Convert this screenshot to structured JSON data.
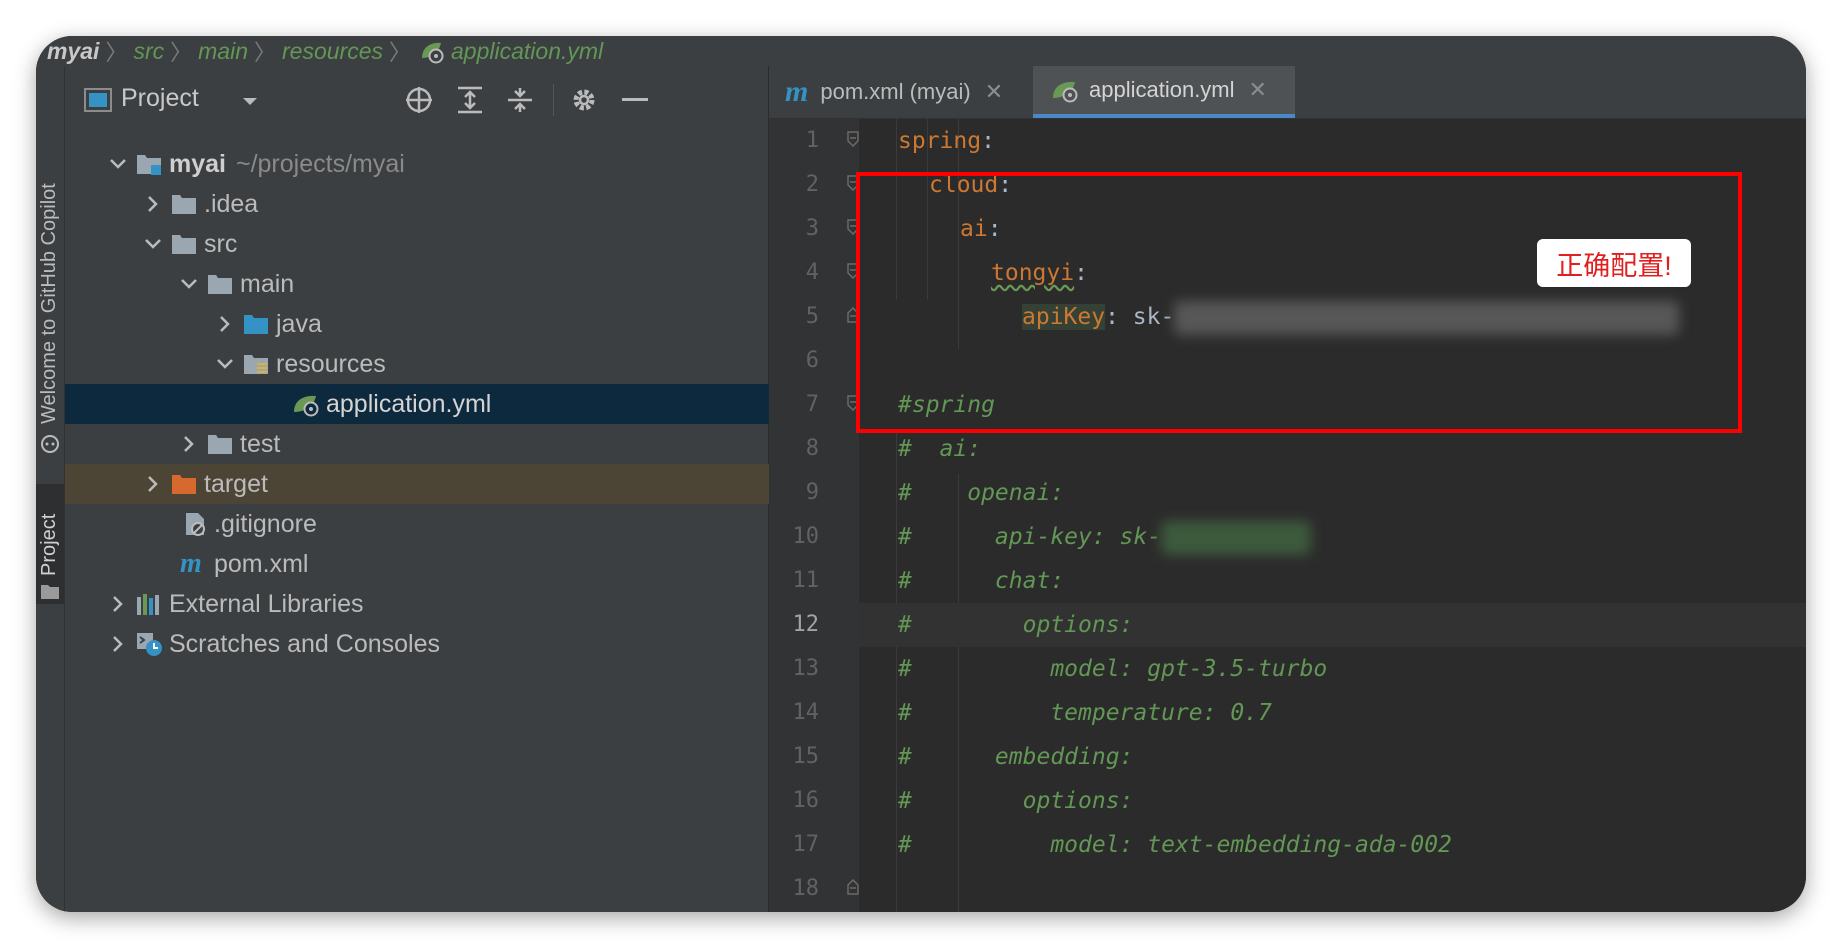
{
  "breadcrumb": [
    "myai",
    "src",
    "main",
    "resources",
    "application.yml"
  ],
  "stripe": {
    "copilot": "Welcome to GitHub Copilot",
    "project": "Project"
  },
  "project_panel": {
    "title": "Project",
    "tree": [
      {
        "name": "myai",
        "path": "~/projects/myai",
        "kind": "module",
        "expanded": true
      },
      {
        "name": ".idea",
        "kind": "folder",
        "expanded": false
      },
      {
        "name": "src",
        "kind": "folder",
        "expanded": true
      },
      {
        "name": "main",
        "kind": "folder",
        "expanded": true
      },
      {
        "name": "java",
        "kind": "source-folder",
        "expanded": false
      },
      {
        "name": "resources",
        "kind": "resources-folder",
        "expanded": true
      },
      {
        "name": "application.yml",
        "kind": "yml-file",
        "selected": true
      },
      {
        "name": "test",
        "kind": "folder",
        "expanded": false
      },
      {
        "name": "target",
        "kind": "excluded-folder",
        "expanded": false
      },
      {
        "name": ".gitignore",
        "kind": "ignore-file"
      },
      {
        "name": "pom.xml",
        "kind": "maven-file"
      },
      {
        "name": "External Libraries",
        "kind": "libraries",
        "expanded": false
      },
      {
        "name": "Scratches and Consoles",
        "kind": "scratches",
        "expanded": false
      }
    ]
  },
  "editor_tabs": [
    {
      "label": "pom.xml (myai)",
      "active": false
    },
    {
      "label": "application.yml",
      "active": true
    }
  ],
  "code": {
    "current_line": 12,
    "lines": [
      {
        "n": 1,
        "key": "spring",
        "rest": ":"
      },
      {
        "n": 2,
        "key": "cloud",
        "rest": ":"
      },
      {
        "n": 3,
        "key": "ai",
        "rest": ":"
      },
      {
        "n": 4,
        "key": "tongyi",
        "rest": ":"
      },
      {
        "n": 5,
        "key": "apiKey",
        "rest": ": sk-"
      },
      {
        "n": 6,
        "text": ""
      },
      {
        "n": 7,
        "comment": "#spring"
      },
      {
        "n": 8,
        "comment": "#  ai:"
      },
      {
        "n": 9,
        "comment": "#    openai:"
      },
      {
        "n": 10,
        "comment": "#      api-key: sk-"
      },
      {
        "n": 11,
        "comment": "#      chat:"
      },
      {
        "n": 12,
        "comment": "#        options:"
      },
      {
        "n": 13,
        "comment": "#          model: gpt-3.5-turbo"
      },
      {
        "n": 14,
        "comment": "#          temperature: 0.7"
      },
      {
        "n": 15,
        "comment": "#      embedding:"
      },
      {
        "n": 16,
        "comment": "#        options:"
      },
      {
        "n": 17,
        "comment": "#          model: text-embedding-ada-002"
      },
      {
        "n": 18,
        "text": ""
      }
    ]
  },
  "annotation": {
    "note": "正确配置!",
    "box_color": "#ff0000"
  },
  "colors": {
    "keyword": "#cc7832",
    "comment": "#629755",
    "selection": "#0d293e",
    "accent": "#4a88c7"
  }
}
